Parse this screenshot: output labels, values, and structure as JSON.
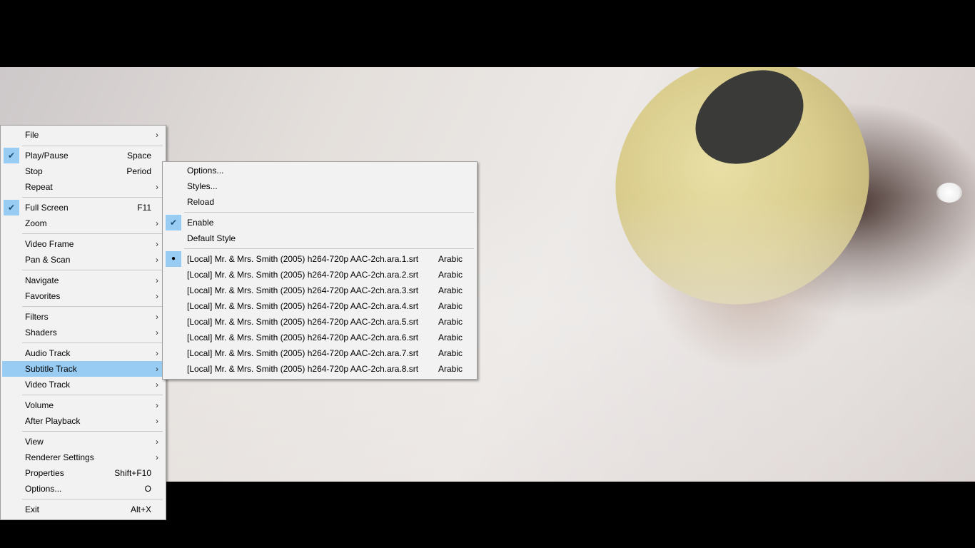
{
  "main_menu": {
    "file": "File",
    "play_pause": "Play/Pause",
    "play_pause_key": "Space",
    "stop": "Stop",
    "stop_key": "Period",
    "repeat": "Repeat",
    "full_screen": "Full Screen",
    "full_screen_key": "F11",
    "zoom": "Zoom",
    "video_frame": "Video Frame",
    "pan_scan": "Pan & Scan",
    "navigate": "Navigate",
    "favorites": "Favorites",
    "filters": "Filters",
    "shaders": "Shaders",
    "audio_track": "Audio Track",
    "subtitle_track": "Subtitle Track",
    "video_track": "Video Track",
    "volume": "Volume",
    "after_playback": "After Playback",
    "view": "View",
    "renderer_settings": "Renderer Settings",
    "properties": "Properties",
    "properties_key": "Shift+F10",
    "options": "Options...",
    "options_key": "O",
    "exit": "Exit",
    "exit_key": "Alt+X"
  },
  "subtitle_menu": {
    "options": "Options...",
    "styles": "Styles...",
    "reload": "Reload",
    "enable": "Enable",
    "default_style": "Default Style",
    "tracks": [
      {
        "name": "[Local] Mr. & Mrs. Smith (2005) h264-720p AAC-2ch.ara.1.srt",
        "lang": "Arabic"
      },
      {
        "name": "[Local] Mr. & Mrs. Smith (2005) h264-720p AAC-2ch.ara.2.srt",
        "lang": "Arabic"
      },
      {
        "name": "[Local] Mr. & Mrs. Smith (2005) h264-720p AAC-2ch.ara.3.srt",
        "lang": "Arabic"
      },
      {
        "name": "[Local] Mr. & Mrs. Smith (2005) h264-720p AAC-2ch.ara.4.srt",
        "lang": "Arabic"
      },
      {
        "name": "[Local] Mr. & Mrs. Smith (2005) h264-720p AAC-2ch.ara.5.srt",
        "lang": "Arabic"
      },
      {
        "name": "[Local] Mr. & Mrs. Smith (2005) h264-720p AAC-2ch.ara.6.srt",
        "lang": "Arabic"
      },
      {
        "name": "[Local] Mr. & Mrs. Smith (2005) h264-720p AAC-2ch.ara.7.srt",
        "lang": "Arabic"
      },
      {
        "name": "[Local] Mr. & Mrs. Smith (2005) h264-720p AAC-2ch.ara.8.srt",
        "lang": "Arabic"
      }
    ]
  },
  "icons": {
    "check": "checkmark-icon",
    "bullet": "radio-bullet-icon",
    "submenu": "chevron-right-icon"
  },
  "colors": {
    "highlight": "#99ccf3",
    "menu_bg": "#f2f2f2"
  }
}
